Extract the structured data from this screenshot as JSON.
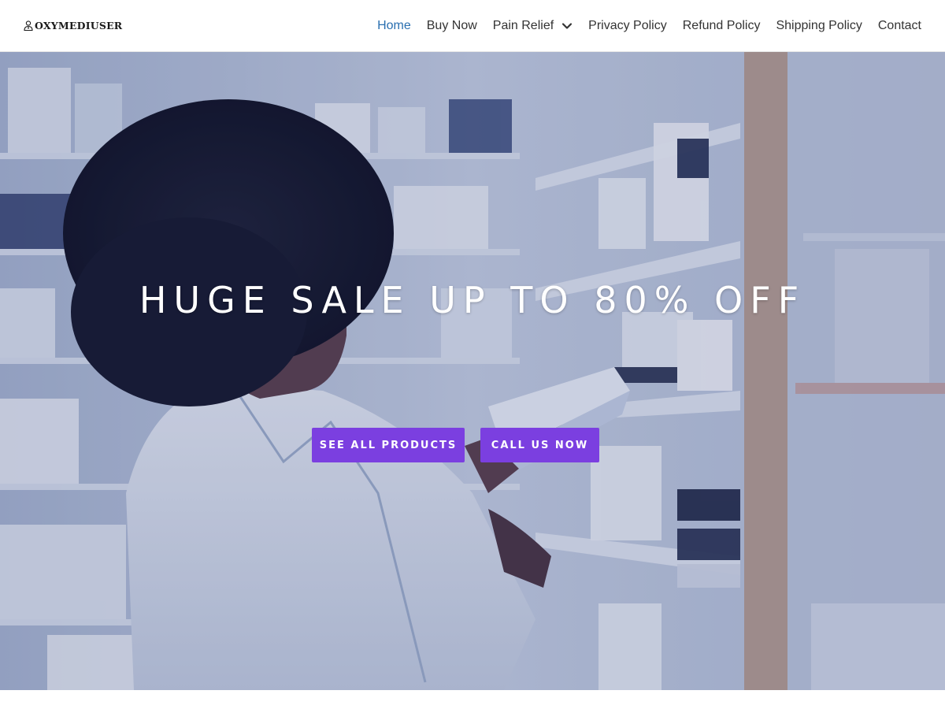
{
  "header": {
    "logo_text": "OXYMEDIUSER",
    "logo_icon": "pharmacist-icon",
    "nav": [
      {
        "label": "Home",
        "active": true
      },
      {
        "label": "Buy Now"
      },
      {
        "label": "Pain Relief",
        "has_dropdown": true
      },
      {
        "label": "Privacy Policy"
      },
      {
        "label": "Refund Policy"
      },
      {
        "label": "Shipping Policy"
      },
      {
        "label": "Contact"
      }
    ]
  },
  "hero": {
    "title": "HUGE SALE UP TO 80% OFF",
    "buttons": {
      "products": "SEE ALL PRODUCTS",
      "call": "CALL US NOW"
    }
  },
  "colors": {
    "accent": "#7b3fe0",
    "nav_active": "#2a6fb0",
    "nav_text": "#333333"
  }
}
